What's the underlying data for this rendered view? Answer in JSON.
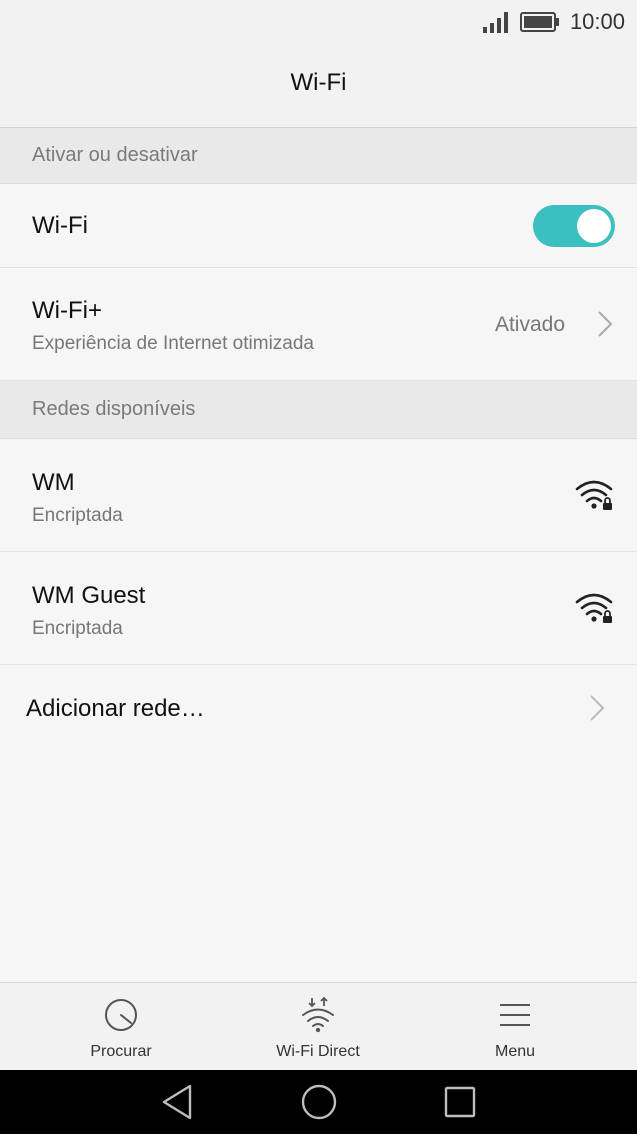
{
  "status_bar": {
    "time": "10:00"
  },
  "header": {
    "title": "Wi-Fi"
  },
  "section_toggle": {
    "label": "Ativar ou desativar"
  },
  "wifi_row": {
    "label": "Wi-Fi",
    "toggle_on": true
  },
  "wifi_plus_row": {
    "label": "Wi-Fi+",
    "sublabel": "Experiência de Internet otimizada",
    "value": "Ativado"
  },
  "section_networks": {
    "label": "Redes disponíveis"
  },
  "networks": [
    {
      "name": "WM",
      "security": "Encriptada",
      "icon": "wifi-locked-icon"
    },
    {
      "name": "WM Guest",
      "security": "Encriptada",
      "icon": "wifi-locked-icon"
    }
  ],
  "add_network": {
    "label": "Adicionar rede…"
  },
  "bottom_bar": {
    "scan_label": "Procurar",
    "direct_label": "Wi-Fi Direct",
    "menu_label": "Menu"
  },
  "colors": {
    "accent": "#3bc0bf"
  }
}
